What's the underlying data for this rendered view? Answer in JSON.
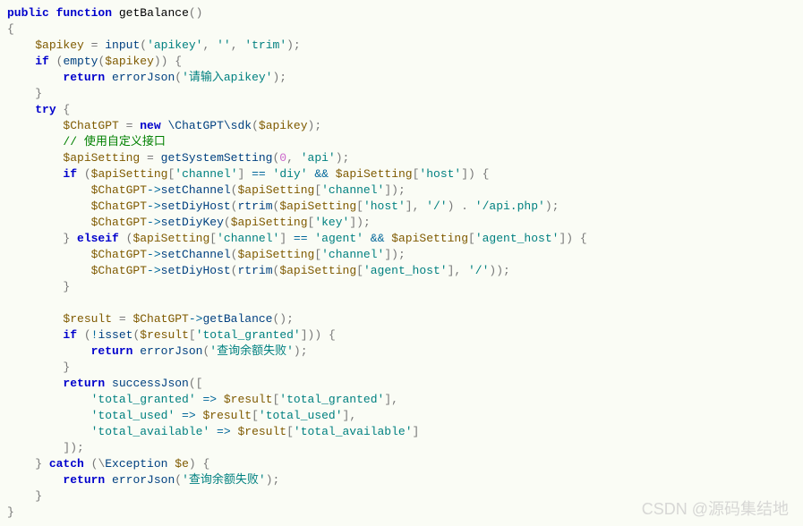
{
  "watermark": "CSDN @源码集结地",
  "code": {
    "l1": {
      "kw1": "public",
      "kw2": "function",
      "name": "getBalance",
      "p1": "()"
    },
    "l2": {
      "p": "{"
    },
    "l3": {
      "var": "$apikey",
      "op": " = ",
      "fn": "input",
      "p1": "(",
      "s1": "'apikey'",
      "c1": ", ",
      "s2": "''",
      "c2": ", ",
      "s3": "'trim'",
      "p2": ");"
    },
    "l4": {
      "kw": "if",
      "p1": " (",
      "fn": "empty",
      "p2": "(",
      "var": "$apikey",
      "p3": ")) {"
    },
    "l5": {
      "kw": "return",
      "sp": " ",
      "fn": "errorJson",
      "p1": "(",
      "s": "'请输入apikey'",
      "p2": ");"
    },
    "l6": {
      "p": "}"
    },
    "l7": {
      "kw": "try",
      "p": " {"
    },
    "l8": {
      "var": "$ChatGPT",
      "op": " = ",
      "kw": "new",
      "sp": " ",
      "cls": "\\ChatGPT\\sdk",
      "p1": "(",
      "var2": "$apikey",
      "p2": ");"
    },
    "l9": {
      "com": "// 使用自定义接口"
    },
    "l10": {
      "var": "$apiSetting",
      "op": " = ",
      "fn": "getSystemSetting",
      "p1": "(",
      "num": "0",
      "c1": ", ",
      "s": "'api'",
      "p2": ");"
    },
    "l11": {
      "kw": "if",
      "p1": " (",
      "var": "$apiSetting",
      "p2": "[",
      "s1": "'channel'",
      "p3": "] ",
      "op1": "==",
      "sp1": " ",
      "s2": "'diy'",
      "sp2": " ",
      "op2": "&&",
      "sp3": " ",
      "var2": "$apiSetting",
      "p4": "[",
      "s3": "'host'",
      "p5": "]) {"
    },
    "l12": {
      "var": "$ChatGPT",
      "arrow": "->",
      "fn": "setChannel",
      "p1": "(",
      "var2": "$apiSetting",
      "p2": "[",
      "s": "'channel'",
      "p3": "]);"
    },
    "l13": {
      "var": "$ChatGPT",
      "arrow": "->",
      "fn": "setDiyHost",
      "p1": "(",
      "fn2": "rtrim",
      "p2": "(",
      "var2": "$apiSetting",
      "p3": "[",
      "s1": "'host'",
      "p4": "], ",
      "s2": "'/'",
      "p5": ") . ",
      "s3": "'/api.php'",
      "p6": ");"
    },
    "l14": {
      "var": "$ChatGPT",
      "arrow": "->",
      "fn": "setDiyKey",
      "p1": "(",
      "var2": "$apiSetting",
      "p2": "[",
      "s": "'key'",
      "p3": "]);"
    },
    "l15": {
      "p1": "} ",
      "kw": "elseif",
      "p2": " (",
      "var": "$apiSetting",
      "p3": "[",
      "s1": "'channel'",
      "p4": "] ",
      "op1": "==",
      "sp1": " ",
      "s2": "'agent'",
      "sp2": " ",
      "op2": "&&",
      "sp3": " ",
      "var2": "$apiSetting",
      "p5": "[",
      "s3": "'agent_host'",
      "p6": "]) {"
    },
    "l16": {
      "var": "$ChatGPT",
      "arrow": "->",
      "fn": "setChannel",
      "p1": "(",
      "var2": "$apiSetting",
      "p2": "[",
      "s": "'channel'",
      "p3": "]);"
    },
    "l17": {
      "var": "$ChatGPT",
      "arrow": "->",
      "fn": "setDiyHost",
      "p1": "(",
      "fn2": "rtrim",
      "p2": "(",
      "var2": "$apiSetting",
      "p3": "[",
      "s1": "'agent_host'",
      "p4": "], ",
      "s2": "'/'",
      "p5": "));"
    },
    "l18": {
      "p": "}"
    },
    "l19": {
      "blank": ""
    },
    "l20": {
      "var": "$result",
      "op": " = ",
      "var2": "$ChatGPT",
      "arrow": "->",
      "fn": "getBalance",
      "p": "();"
    },
    "l21": {
      "kw": "if",
      "p1": " (",
      "op": "!",
      "fn": "isset",
      "p2": "(",
      "var": "$result",
      "p3": "[",
      "s": "'total_granted'",
      "p4": "])) {"
    },
    "l22": {
      "kw": "return",
      "sp": " ",
      "fn": "errorJson",
      "p1": "(",
      "s": "'查询余额失败'",
      "p2": ");"
    },
    "l23": {
      "p": "}"
    },
    "l24": {
      "kw": "return",
      "sp": " ",
      "fn": "successJson",
      "p": "(["
    },
    "l25": {
      "s1": "'total_granted'",
      "op": " => ",
      "var": "$result",
      "p1": "[",
      "s2": "'total_granted'",
      "p2": "],"
    },
    "l26": {
      "s1": "'total_used'",
      "op": " => ",
      "var": "$result",
      "p1": "[",
      "s2": "'total_used'",
      "p2": "],"
    },
    "l27": {
      "s1": "'total_available'",
      "op": " => ",
      "var": "$result",
      "p1": "[",
      "s2": "'total_available'",
      "p2": "]"
    },
    "l28": {
      "p": "]);"
    },
    "l29": {
      "p1": "} ",
      "kw": "catch",
      "p2": " (\\",
      "cls": "Exception",
      "sp": " ",
      "var": "$e",
      "p3": ") {"
    },
    "l30": {
      "kw": "return",
      "sp": " ",
      "fn": "errorJson",
      "p1": "(",
      "s": "'查询余额失败'",
      "p2": ");"
    },
    "l31": {
      "p": "}"
    },
    "l32": {
      "p": "}"
    }
  }
}
